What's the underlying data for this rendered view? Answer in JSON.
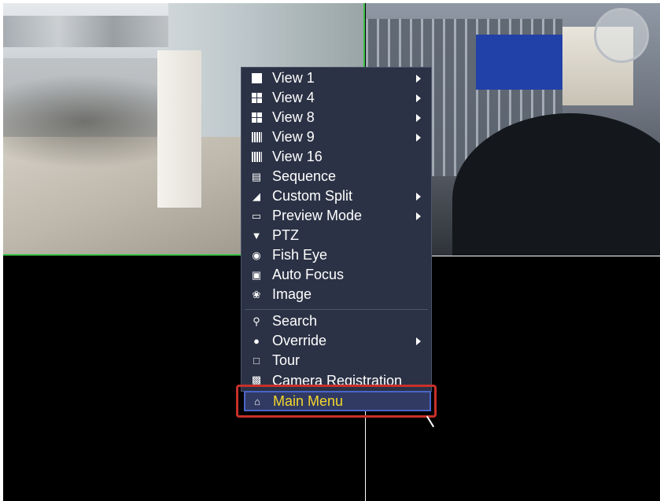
{
  "menu": {
    "items": [
      {
        "label": "View 1",
        "icon": "single-view-icon",
        "submenu": true
      },
      {
        "label": "View 4",
        "icon": "quad-view-icon",
        "submenu": true
      },
      {
        "label": "View 8",
        "icon": "eight-split-icon",
        "submenu": true
      },
      {
        "label": "View 9",
        "icon": "nine-split-icon",
        "submenu": true
      },
      {
        "label": "View 16",
        "icon": "sixteen-split-icon",
        "submenu": false
      },
      {
        "label": "Sequence",
        "icon": "sequence-icon",
        "submenu": false
      },
      {
        "label": "Custom Split",
        "icon": "custom-split-icon",
        "submenu": true
      },
      {
        "label": "Preview Mode",
        "icon": "monitor-icon",
        "submenu": true
      },
      {
        "label": "PTZ",
        "icon": "ptz-dome-icon",
        "submenu": false
      },
      {
        "label": "Fish Eye",
        "icon": "fish-eye-icon",
        "submenu": false
      },
      {
        "label": "Auto Focus",
        "icon": "auto-focus-icon",
        "submenu": false
      },
      {
        "label": "Image",
        "icon": "palette-icon",
        "submenu": false
      },
      {
        "label": "Search",
        "icon": "search-icon",
        "submenu": false
      },
      {
        "label": "Override",
        "icon": "mouse-icon",
        "submenu": true
      },
      {
        "label": "Tour",
        "icon": "tour-icon",
        "submenu": false
      },
      {
        "label": "Camera Registration",
        "icon": "camera-registration-icon",
        "submenu": false
      },
      {
        "label": "Main Menu",
        "icon": "home-icon",
        "submenu": false,
        "selected": true
      }
    ]
  },
  "colors": {
    "menu_bg": "#2b3245",
    "selected_text": "#f4d72c",
    "highlight_box": "#c8302a",
    "active_tile_border": "#3cc34a"
  }
}
